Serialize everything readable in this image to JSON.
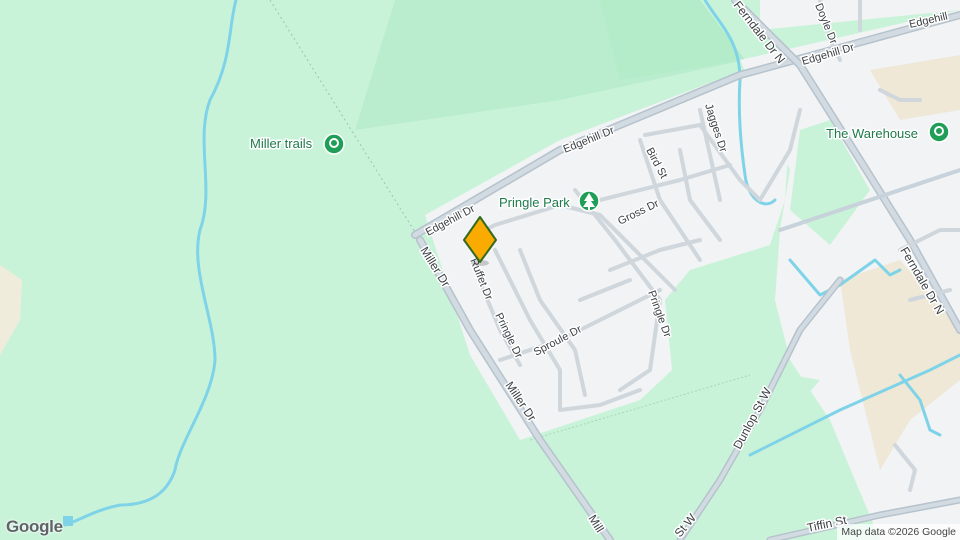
{
  "map": {
    "attribution": "Map data ©2026 Google",
    "logo_text": "Google",
    "colors": {
      "park": "#c9f3d9",
      "forest": "#b4ebc9",
      "urban": "#f1f3f4",
      "road": "#ffffff",
      "major_road": "#c7d2db",
      "water": "#7cd4ec",
      "poi_green": "#1e9e57",
      "marker": "#f9ab00",
      "marker_border": "#336a1e"
    },
    "pois": {
      "miller_trails": {
        "label": "Miller trails",
        "icon": "pin-icon"
      },
      "pringle_park": {
        "label": "Pringle Park",
        "icon": "tree-icon"
      },
      "the_warehouse": {
        "label": "The Warehouse",
        "icon": "shopping-bag-icon"
      }
    },
    "streets": {
      "edgehill_dr_1": "Edgehill Dr",
      "edgehill_dr_2": "Edgehill Dr",
      "edgehill_dr_3": "Edgehill Dr",
      "edgehill_dr_4": "Edgehill",
      "miller_dr_1": "Miller Dr",
      "miller_dr_2": "Miller Dr",
      "miller_dr_3": "Mill",
      "ruffet_dr": "Ruffet Dr",
      "pringle_dr_1": "Pringle Dr",
      "pringle_dr_2": "Pringle Dr",
      "sproule_dr": "Sproule Dr",
      "gross_dr": "Gross Dr",
      "bird_st": "Bird St",
      "jagges_dr": "Jagges Dr",
      "doyle_dr": "Doyle Dr",
      "ferndale_dr_n_1": "Ferndale Dr N",
      "ferndale_dr_n_2": "Ferndale Dr N",
      "dunlop_st_w_1": "Dunlop St W",
      "dunlop_st_w_2": "St W",
      "tiffin_st": "Tiffin St"
    }
  }
}
